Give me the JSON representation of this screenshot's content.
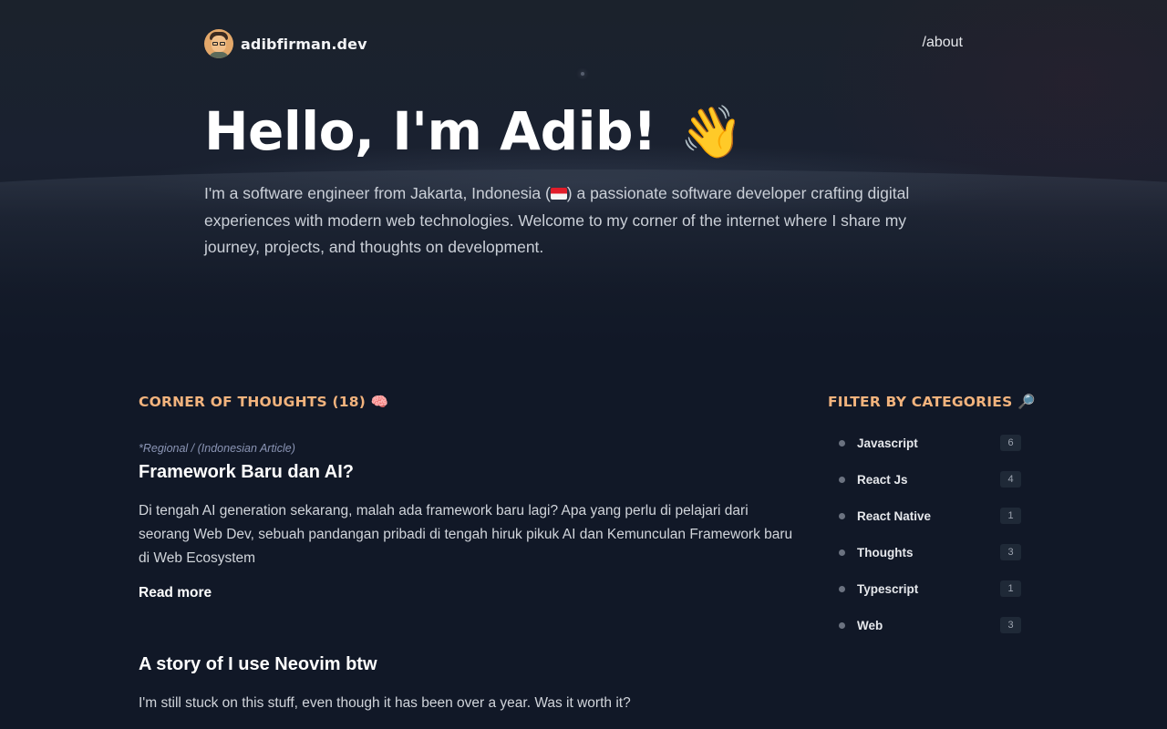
{
  "header": {
    "brand_name": "adibfirman.dev",
    "nav_about": "/about"
  },
  "hero": {
    "title": "Hello, I'm Adib!",
    "wave_emoji": "👋",
    "description_part1": "I'm a software engineer from Jakarta, Indonesia (",
    "description_part2": ") a passionate software developer crafting digital experiences with modern web technologies. Welcome to my corner of the internet where I share my journey, projects, and thoughts on development."
  },
  "posts_section": {
    "heading": "CORNER OF THOUGHTS (18) 🧠",
    "posts": [
      {
        "category": "*Regional / (Indonesian Article)",
        "title": "Framework Baru dan AI?",
        "excerpt": "Di tengah AI generation sekarang, malah ada framework baru lagi? Apa yang perlu di pelajari dari seorang Web Dev, sebuah pandangan pribadi di tengah hiruk pikuk AI dan Kemunculan Framework baru di Web Ecosystem",
        "read_more": "Read more"
      },
      {
        "title": "A story of I use Neovim btw",
        "excerpt": "I'm still stuck on this stuff, even though it has been over a year. Was it worth it?"
      }
    ]
  },
  "filter_section": {
    "heading": "FILTER BY CATEGORIES 🔎",
    "categories": [
      {
        "label": "Javascript",
        "count": "6"
      },
      {
        "label": "React Js",
        "count": "4"
      },
      {
        "label": "React Native",
        "count": "1"
      },
      {
        "label": "Thoughts",
        "count": "3"
      },
      {
        "label": "Typescript",
        "count": "1"
      },
      {
        "label": "Web",
        "count": "3"
      }
    ]
  },
  "colors": {
    "background": "#111827",
    "accent_heading": "#f2b37d",
    "category_meta": "#8b95b5"
  },
  "icons": [
    "avatar-image",
    "waving-hand-emoji",
    "indonesia-flag-icon",
    "brain-emoji",
    "magnifier-emoji",
    "bullet-dot-icon"
  ]
}
